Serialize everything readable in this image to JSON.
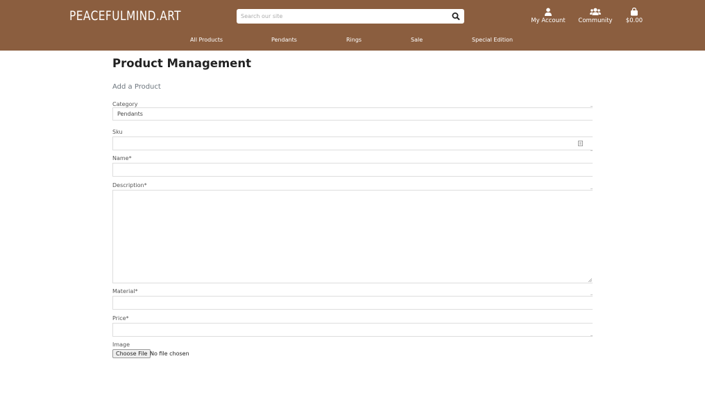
{
  "brand": {
    "logo": "PEACEFULMIND.ART"
  },
  "search": {
    "placeholder": "Search our site"
  },
  "header_nav": {
    "account_label": "My Account",
    "community_label": "Community",
    "cart_label": "$0.00"
  },
  "menu": [
    {
      "label": "All Products"
    },
    {
      "label": "Pendants"
    },
    {
      "label": "Rings"
    },
    {
      "label": "Sale"
    },
    {
      "label": "Special Edition"
    }
  ],
  "page": {
    "title": "Product Management",
    "subtitle": "Add a Product"
  },
  "form": {
    "category_label": "Category",
    "category_value": "Pendants",
    "sku_label": "Sku",
    "name_label": "Name*",
    "description_label": "Description*",
    "material_label": "Material*",
    "price_label": "Price*",
    "image_label": "Image",
    "file_button": "Choose File",
    "file_status": "No file chosen"
  },
  "colors": {
    "header_bg": "#8b5e3f",
    "accent": "#ffffff"
  }
}
